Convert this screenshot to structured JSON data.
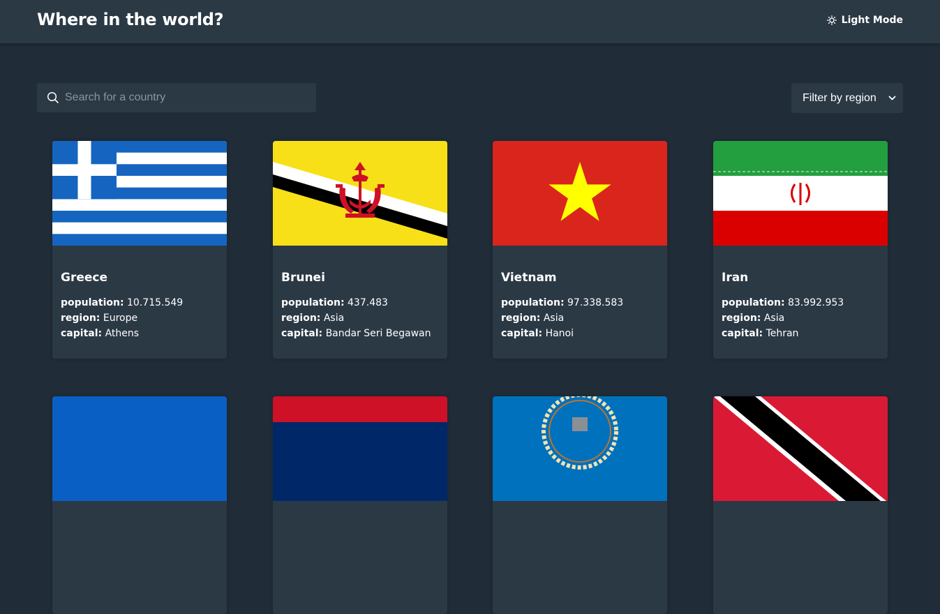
{
  "header": {
    "title": "Where in the world?",
    "theme_toggle_label": "Light Mode",
    "theme_icon": "sun-icon"
  },
  "search": {
    "placeholder": "Search for a country",
    "value": "",
    "icon": "search-icon"
  },
  "filter": {
    "selected": "Filter by region",
    "icon": "chevron-down-icon"
  },
  "labels": {
    "population": "population:",
    "region": "region:",
    "capital": "capital:"
  },
  "countries": [
    {
      "name": "Greece",
      "population": "10.715.549",
      "region": "Europe",
      "capital": "Athens",
      "flag_icon": "greece-flag"
    },
    {
      "name": "Brunei",
      "population": "437.483",
      "region": "Asia",
      "capital": "Bandar Seri Begawan",
      "flag_icon": "brunei-flag"
    },
    {
      "name": "Vietnam",
      "population": "97.338.583",
      "region": "Asia",
      "capital": "Hanoi",
      "flag_icon": "vietnam-flag"
    },
    {
      "name": "Iran",
      "population": "83.992.953",
      "region": "Asia",
      "capital": "Tehran",
      "flag_icon": "iran-flag"
    }
  ],
  "colors": {
    "background": "#202c37",
    "element": "#2b3945",
    "text": "#ffffff",
    "placeholder": "#8b949c"
  }
}
